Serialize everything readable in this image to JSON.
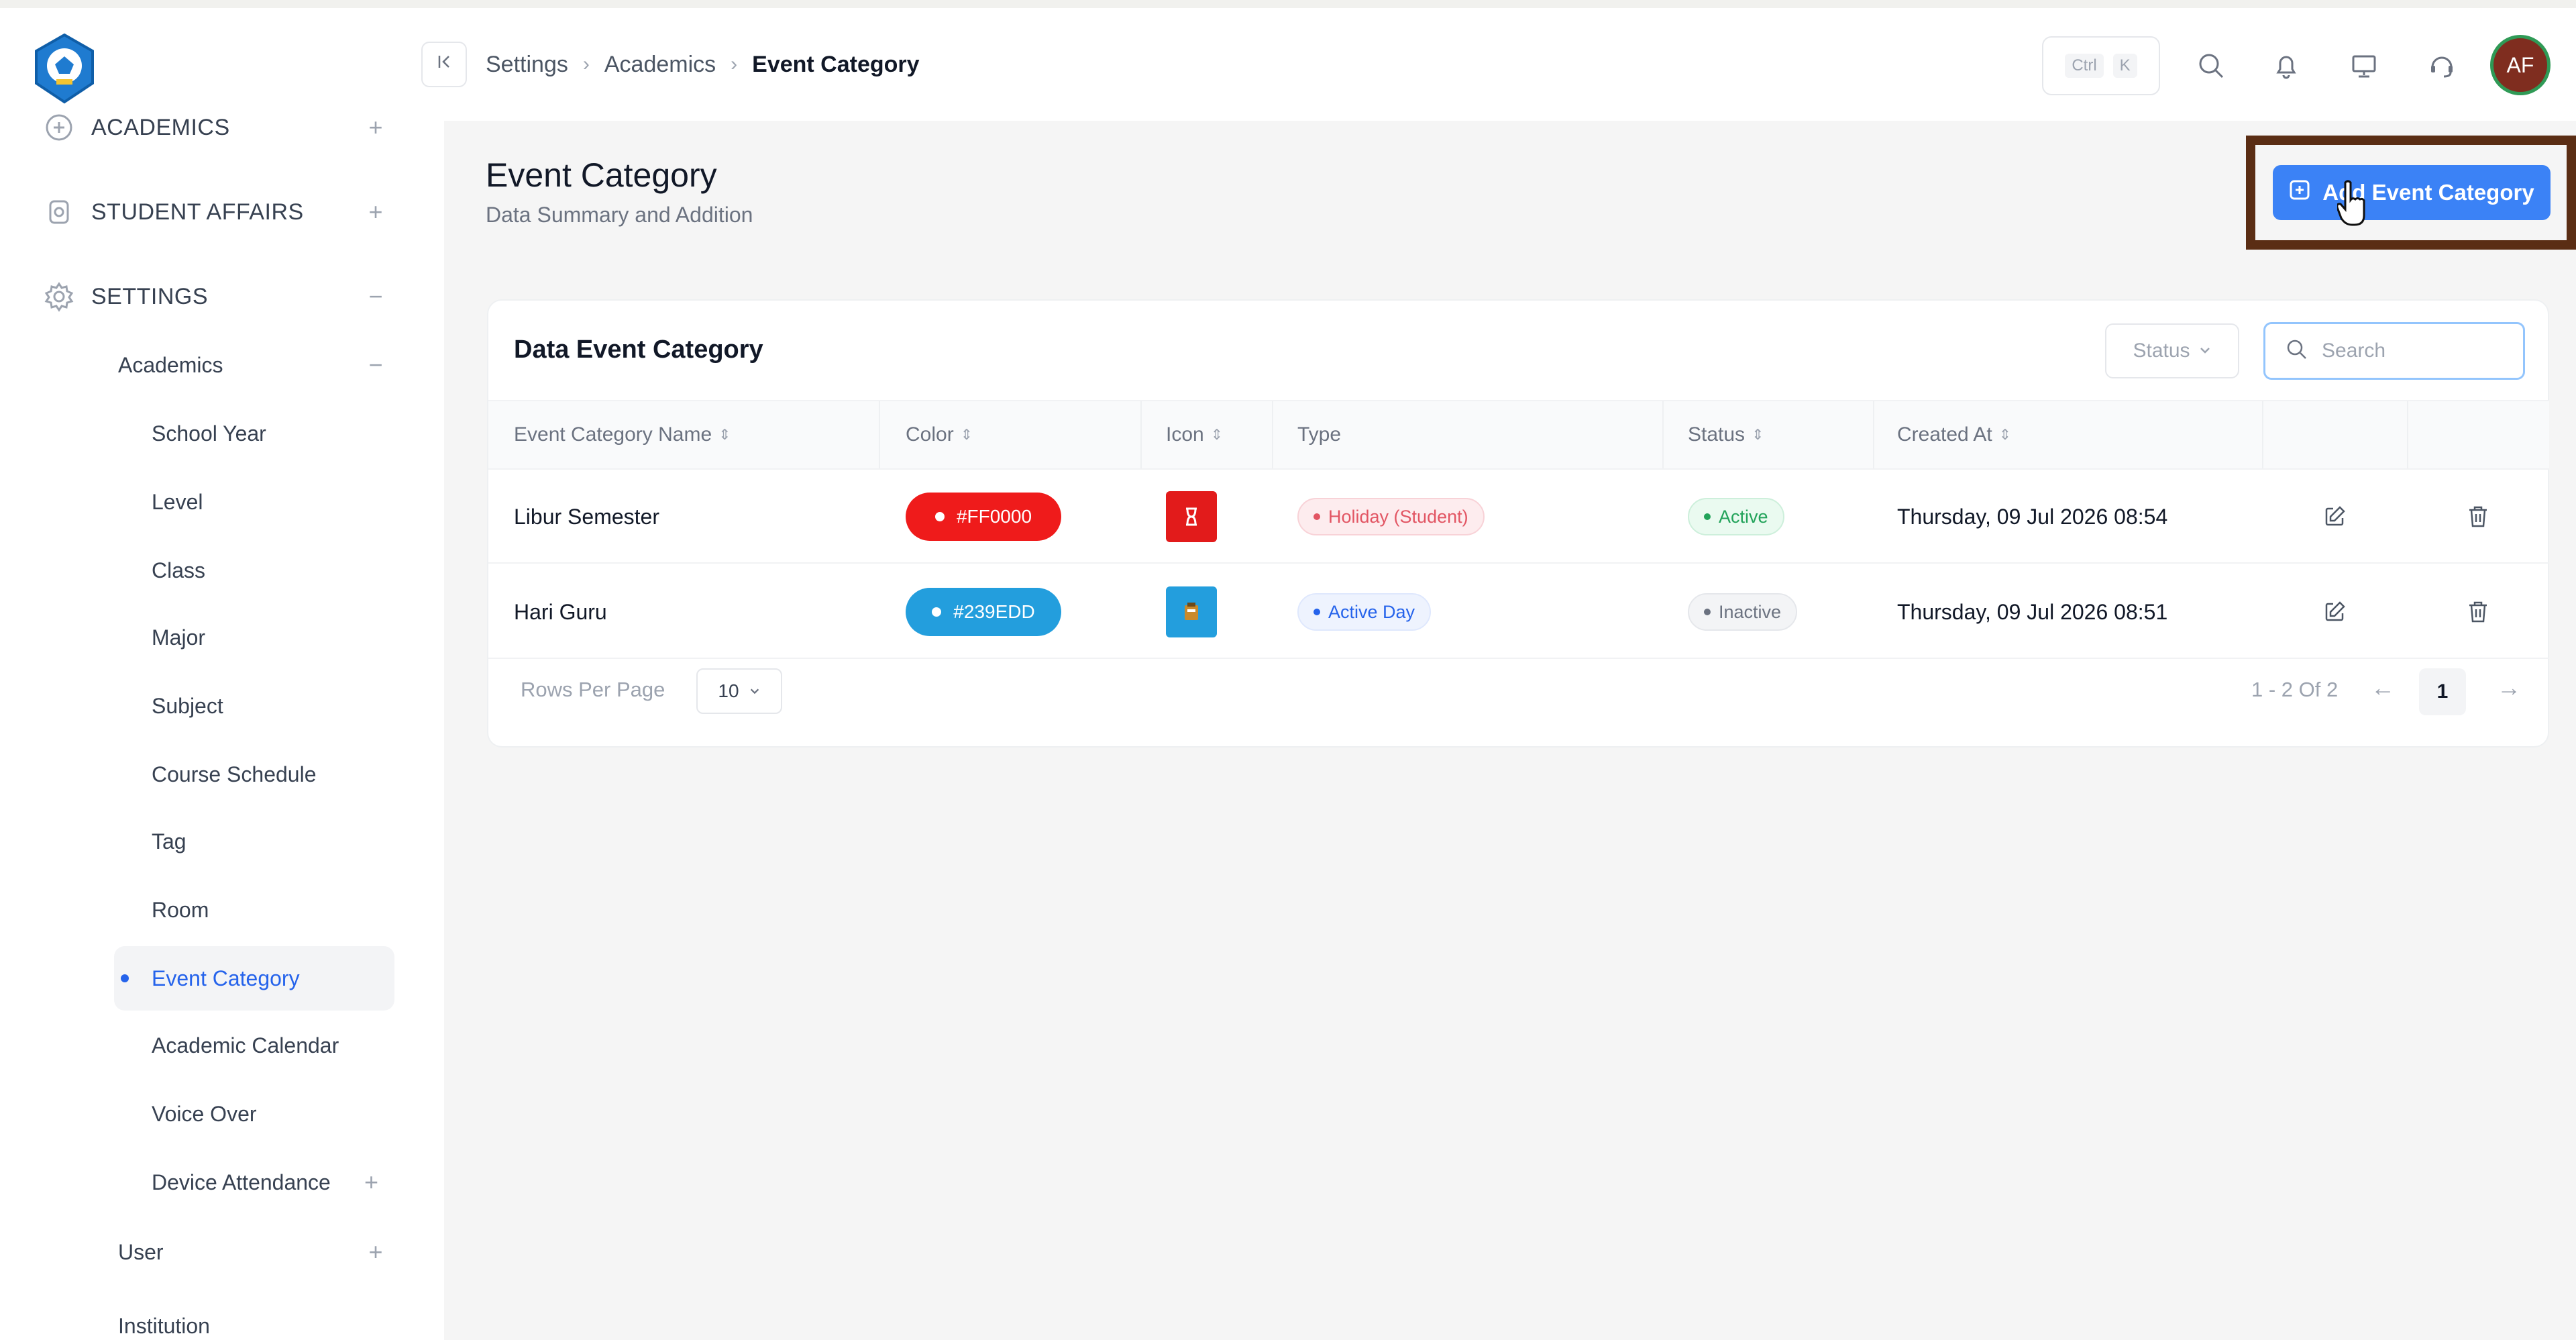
{
  "sidebar": {
    "sections": [
      {
        "label": "ACADEMICS",
        "toggle": "+",
        "icon": "academics-icon"
      },
      {
        "label": "STUDENT AFFAIRS",
        "toggle": "+",
        "icon": "student-affairs-icon"
      },
      {
        "label": "SETTINGS",
        "toggle": "−",
        "icon": "gear-icon"
      }
    ],
    "academics_group": {
      "label": "Academics",
      "toggle": "−"
    },
    "items": [
      {
        "label": "School Year"
      },
      {
        "label": "Level"
      },
      {
        "label": "Class"
      },
      {
        "label": "Major"
      },
      {
        "label": "Subject"
      },
      {
        "label": "Course Schedule"
      },
      {
        "label": "Tag"
      },
      {
        "label": "Room"
      },
      {
        "label": "Event Category"
      },
      {
        "label": "Academic Calendar"
      },
      {
        "label": "Voice Over"
      },
      {
        "label": "Device Attendance",
        "toggle": "+"
      }
    ],
    "user_group": {
      "label": "User",
      "toggle": "+"
    },
    "institution_group": {
      "label": "Institution"
    }
  },
  "topbar": {
    "collapse_icon": "collapse-sidebar-icon",
    "breadcrumb": [
      "Settings",
      "Academics",
      "Event Category"
    ],
    "shortcut": [
      "Ctrl",
      "K"
    ],
    "icons": [
      "search-icon",
      "bell-icon",
      "monitor-icon",
      "support-icon"
    ],
    "avatar_initials": "AF"
  },
  "page": {
    "title": "Event Category",
    "subtitle": "Data Summary and Addition",
    "add_button": "Add Event Category"
  },
  "card": {
    "title": "Data Event Category",
    "status_filter": "Status",
    "search_placeholder": "Search",
    "columns": [
      "Event Category Name",
      "Color",
      "Icon",
      "Type",
      "Status",
      "Created At"
    ],
    "rows": [
      {
        "name": "Libur Semester",
        "color_label": "#FF0000",
        "color_hex": "#ef1b1b",
        "icon_bg": "#e21b1b",
        "type": "Holiday (Student)",
        "status": "Active",
        "created_at": "Thursday, 09 Jul 2026 08:54"
      },
      {
        "name": "Hari Guru",
        "color_label": "#239EDD",
        "color_hex": "#239edd",
        "icon_bg": "#239edd",
        "type": "Active Day",
        "status": "Inactive",
        "created_at": "Thursday, 09 Jul 2026 08:51"
      }
    ],
    "rows_per_page_label": "Rows Per Page",
    "rows_per_page": "10",
    "pagination_range": "1 - 2 Of 2",
    "current_page": "1"
  }
}
